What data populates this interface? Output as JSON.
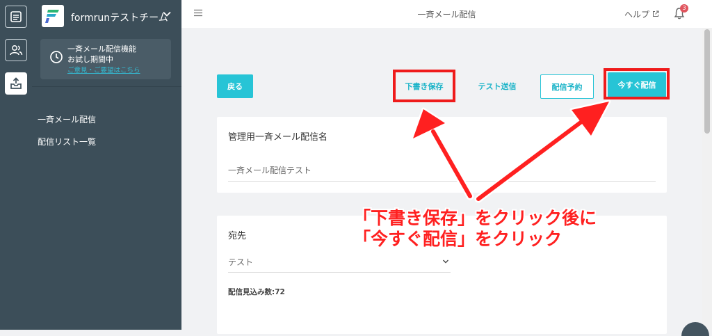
{
  "app": {
    "team_name": "formrunテストチーム",
    "page_title": "一斉メール配信",
    "help_label": "ヘルプ",
    "notification_count": "3"
  },
  "rail": {
    "items": [
      {
        "icon": "form-list-icon"
      },
      {
        "icon": "users-icon"
      },
      {
        "icon": "inbox-upload-icon"
      }
    ]
  },
  "sidebar": {
    "trial_title": "一斉メール配信機能",
    "trial_status": "お試し期間中",
    "trial_link": "ご意見・ご要望はこちら",
    "nav": [
      {
        "label": "一斉メール配信"
      },
      {
        "label": "配信リスト一覧"
      }
    ]
  },
  "toolbar": {
    "back_label": "戻る",
    "draft_label": "下書き保存",
    "test_label": "テスト送信",
    "schedule_label": "配信予約",
    "send_now_label": "今すぐ配信"
  },
  "form": {
    "name_label": "管理用一斉メール配信名",
    "name_value": "一斉メール配信テスト",
    "recipient_label": "宛先",
    "recipient_value": "テスト",
    "estimate_label": "配信見込み数:72"
  },
  "annotation": {
    "line1": "「下書き保存」をクリック後に",
    "line2": "「今すぐ配信」をクリック",
    "color": "#ff2020"
  },
  "colors": {
    "sidebar": "#3c4e59",
    "accent": "#27c4d6",
    "highlight": "#ef1b1b"
  }
}
